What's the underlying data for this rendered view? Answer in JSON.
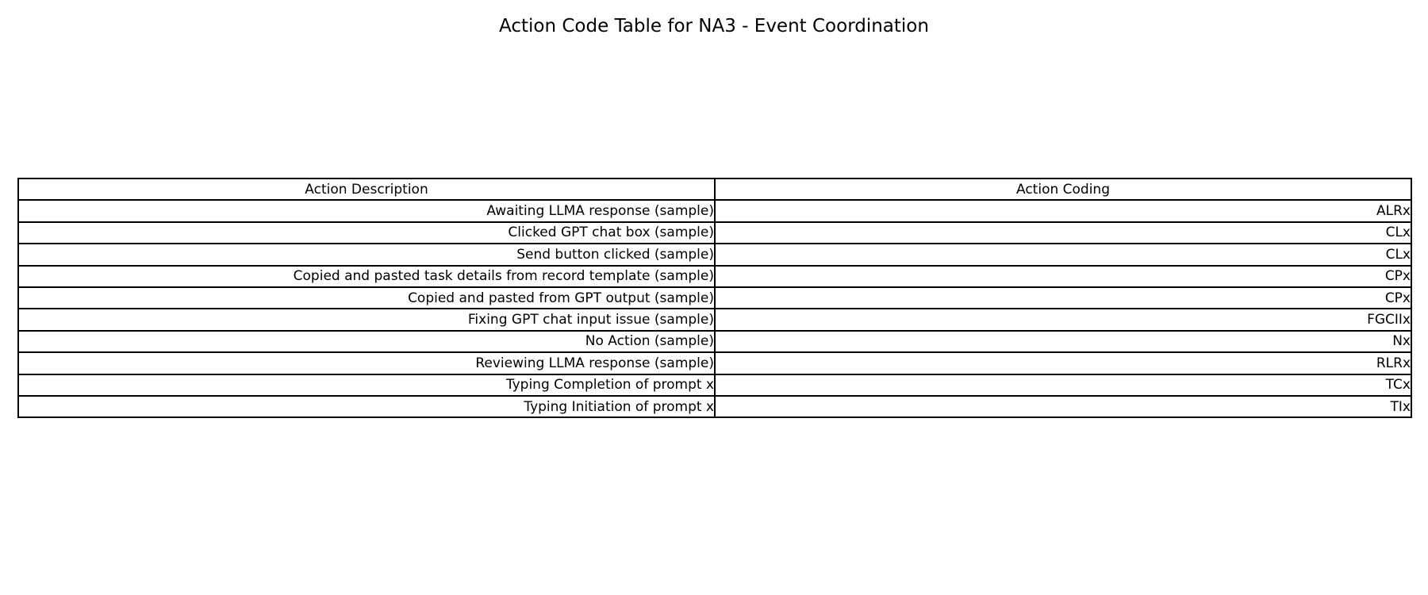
{
  "chart_data": {
    "type": "table",
    "title": "Action Code Table for NA3 - Event Coordination",
    "columns": [
      "Action Description",
      "Action Coding"
    ],
    "rows": [
      [
        "Awaiting LLMA response (sample)",
        "ALRx"
      ],
      [
        "Clicked GPT chat box (sample)",
        "CLx"
      ],
      [
        "Send button clicked (sample)",
        "CLx"
      ],
      [
        "Copied and pasted task details from record template (sample)",
        "CPx"
      ],
      [
        "Copied and pasted from GPT output (sample)",
        "CPx"
      ],
      [
        "Fixing GPT chat input issue (sample)",
        "FGCIIx"
      ],
      [
        "No Action (sample)",
        "Nx"
      ],
      [
        "Reviewing LLMA response (sample)",
        "RLRx"
      ],
      [
        "Typing Completion of prompt x",
        "TCx"
      ],
      [
        "Typing Initiation of prompt x",
        "TIx"
      ]
    ]
  }
}
